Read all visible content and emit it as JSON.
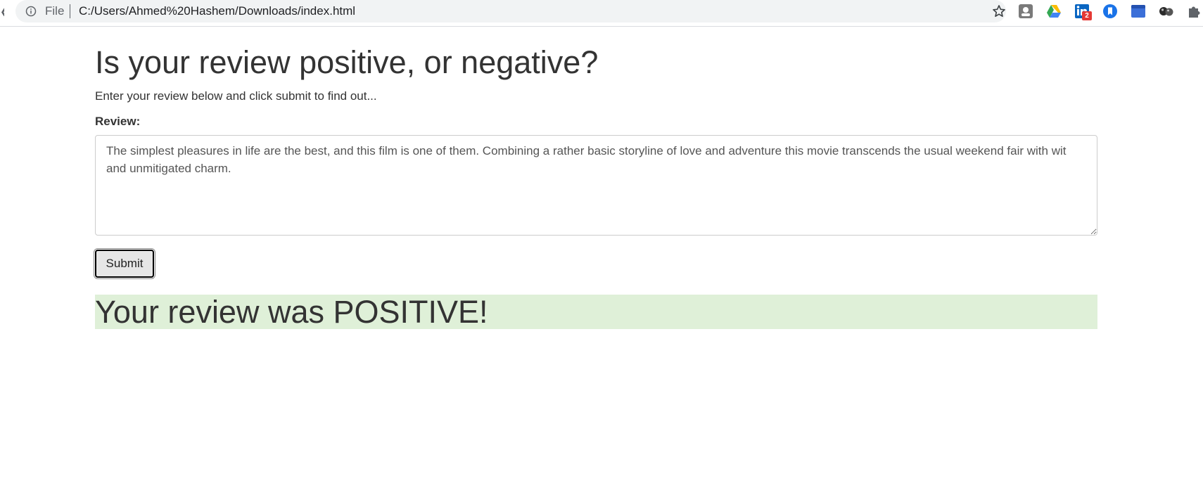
{
  "browser": {
    "file_label": "File",
    "url": "C:/Users/Ahmed%20Hashem/Downloads/index.html",
    "extensions": [
      {
        "name": "extension-portrait-icon"
      },
      {
        "name": "google-drive-icon"
      },
      {
        "name": "linkedin-icon",
        "badge": "2"
      },
      {
        "name": "bookmark-circle-icon"
      },
      {
        "name": "window-extension-icon"
      },
      {
        "name": "balls-extension-icon"
      },
      {
        "name": "puzzle-icon"
      }
    ]
  },
  "page": {
    "title": "Is your review positive, or negative?",
    "lead": "Enter your review below and click submit to find out...",
    "review_label": "Review:",
    "review_text": "The simplest pleasures in life are the best, and this film is one of them. Combining a rather basic storyline of love and adventure this movie transcends the usual weekend fair with wit and unmitigated charm.",
    "submit_label": "Submit",
    "result_text": "Your review was POSITIVE!"
  },
  "colors": {
    "result_background": "#dff0d8",
    "text": "#333333"
  }
}
